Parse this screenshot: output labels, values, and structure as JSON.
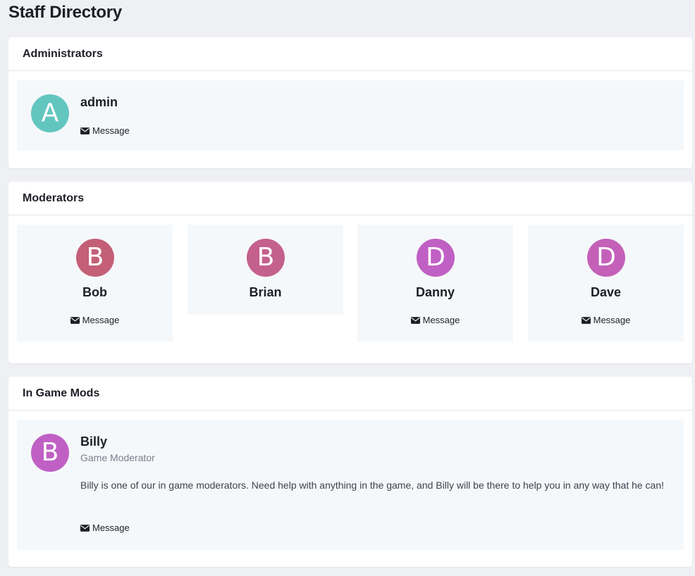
{
  "page": {
    "title": "Staff Directory"
  },
  "sections": {
    "administrators": {
      "title": "Administrators",
      "members": [
        {
          "initial": "A",
          "name": "admin",
          "color": "#62c6bf",
          "message_label": "Message"
        }
      ]
    },
    "moderators": {
      "title": "Moderators",
      "members": [
        {
          "initial": "B",
          "name": "Bob",
          "color": "#c45f78",
          "message_label": "Message"
        },
        {
          "initial": "B",
          "name": "Brian",
          "color": "#c4608c"
        },
        {
          "initial": "D",
          "name": "Danny",
          "color": "#c060c4",
          "message_label": "Message"
        },
        {
          "initial": "D",
          "name": "Dave",
          "color": "#c460b8",
          "message_label": "Message"
        }
      ]
    },
    "in_game_mods": {
      "title": "In Game Mods",
      "members": [
        {
          "initial": "B",
          "name": "Billy",
          "color": "#c060c4",
          "role": "Game Moderator",
          "bio": "Billy is one of our in game moderators. Need help with anything in the game, and Billy will be there to help you in any way that he can!",
          "message_label": "Message"
        }
      ]
    }
  },
  "icons": {
    "message": "envelope-icon"
  }
}
